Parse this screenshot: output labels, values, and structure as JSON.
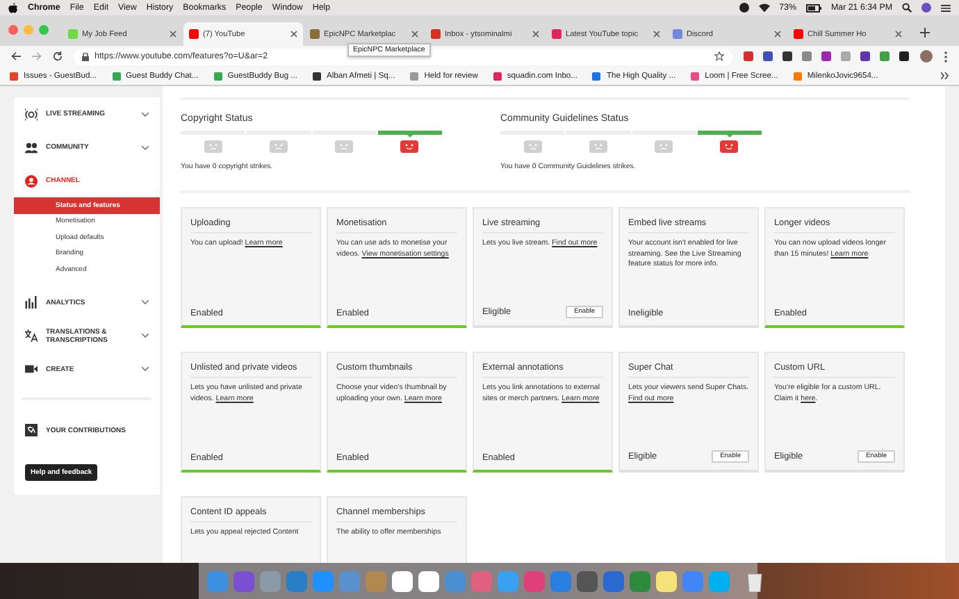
{
  "menubar": {
    "app": "Chrome",
    "menus": [
      "File",
      "Edit",
      "View",
      "History",
      "Bookmarks",
      "People",
      "Window",
      "Help"
    ],
    "battery": "73%",
    "clock": "Mar 21 6:34 PM"
  },
  "tabs": [
    {
      "label": "My Job Feed",
      "selected": false
    },
    {
      "label": "(7) YouTube",
      "selected": true
    },
    {
      "label": "EpicNPC Marketplac",
      "selected": false
    },
    {
      "label": "Inbox - ytsominalmi",
      "selected": false
    },
    {
      "label": "Latest YouTube topic",
      "selected": false
    },
    {
      "label": "Discord",
      "selected": false
    },
    {
      "label": "Chill Summer Ho",
      "selected": false
    }
  ],
  "tooltip": "EpicNPC Marketplace",
  "address_bar": {
    "url": "https://www.youtube.com/features?o=U&ar=2"
  },
  "bookmarks": [
    "Issues - GuestBud...",
    "Guest Buddy Chat...",
    "GuestBuddy Bug ...",
    "Alban Afmeti | Sq...",
    "Held for review",
    "squadin.com Inbo...",
    "The High Quality ...",
    "Loom | Free Scree...",
    "MilenkoJovic9654..."
  ],
  "sidebar": {
    "sections": [
      {
        "label": "LIVE STREAMING",
        "selected": false,
        "collapsed": true
      },
      {
        "label": "COMMUNITY",
        "selected": false,
        "collapsed": true
      },
      {
        "label": "CHANNEL",
        "selected": true,
        "collapsed": false,
        "children": [
          {
            "label": "Status and features",
            "selected": true
          },
          {
            "label": "Monetisation",
            "selected": false
          },
          {
            "label": "Upload defaults",
            "selected": false
          },
          {
            "label": "Branding",
            "selected": false
          },
          {
            "label": "Advanced",
            "selected": false
          }
        ]
      },
      {
        "label": "ANALYTICS",
        "selected": false,
        "collapsed": true
      },
      {
        "label": "TRANSLATIONS & TRANSCRIPTIONS",
        "selected": false,
        "collapsed": true
      },
      {
        "label": "CREATE",
        "selected": false,
        "collapsed": true
      }
    ],
    "footer_item": "YOUR CONTRIBUTIONS",
    "help_button": "Help and feedback"
  },
  "strikes": [
    {
      "title": "Copyright Status",
      "segments": [
        {
          "selected": false
        },
        {
          "selected": false
        },
        {
          "selected": false
        },
        {
          "selected": true
        }
      ],
      "message": "You have 0 copyright strikes."
    },
    {
      "title": "Community Guidelines Status",
      "segments": [
        {
          "selected": false
        },
        {
          "selected": false
        },
        {
          "selected": false
        },
        {
          "selected": true
        }
      ],
      "message": "You have 0 Community Guidelines strikes."
    }
  ],
  "cards": [
    {
      "title": "Uploading",
      "parts": [
        {
          "kind": "text",
          "text": "You can upload! "
        },
        {
          "kind": "link",
          "text": "Learn more"
        }
      ],
      "status": "Enabled",
      "enabled": true
    },
    {
      "title": "Monetisation",
      "parts": [
        {
          "kind": "text",
          "text": "You can use ads to monetise your videos. "
        },
        {
          "kind": "link",
          "text": "View monetisation settings"
        }
      ],
      "status": "Enabled",
      "enabled": true
    },
    {
      "title": "Live streaming",
      "parts": [
        {
          "kind": "text",
          "text": "Lets you live stream. "
        },
        {
          "kind": "link",
          "text": "Find out more"
        }
      ],
      "status": "Eligible",
      "enabled": false,
      "button": "Enable"
    },
    {
      "title": "Embed live streams",
      "parts": [
        {
          "kind": "text",
          "text": "Your account isn't enabled for live streaming. See the Live Streaming feature status for more info."
        }
      ],
      "status": "Ineligible",
      "enabled": false
    },
    {
      "title": "Longer videos",
      "parts": [
        {
          "kind": "text",
          "text": "You can now upload videos longer than 15 minutes! "
        },
        {
          "kind": "link",
          "text": "Learn more"
        }
      ],
      "status": "Enabled",
      "enabled": true
    },
    {
      "title": "Unlisted and private videos",
      "parts": [
        {
          "kind": "text",
          "text": "Lets you have unlisted and private videos. "
        },
        {
          "kind": "link",
          "text": "Learn more"
        }
      ],
      "status": "Enabled",
      "enabled": true
    },
    {
      "title": "Custom thumbnails",
      "parts": [
        {
          "kind": "text",
          "text": "Choose your video's thumbnail by uploading your own. "
        },
        {
          "kind": "link",
          "text": "Learn more"
        }
      ],
      "status": "Enabled",
      "enabled": true
    },
    {
      "title": "External annotations",
      "parts": [
        {
          "kind": "text",
          "text": "Lets you link annotations to external sites or merch partners. "
        },
        {
          "kind": "link",
          "text": "Learn more"
        }
      ],
      "status": "Enabled",
      "enabled": true
    },
    {
      "title": "Super Chat",
      "parts": [
        {
          "kind": "text",
          "text": "Lets your viewers send Super Chats. "
        },
        {
          "kind": "link",
          "text": "Find out more"
        }
      ],
      "status": "Eligible",
      "enabled": false,
      "button": "Enable"
    },
    {
      "title": "Custom URL",
      "parts": [
        {
          "kind": "text",
          "text": "You're eligible for a custom URL. Claim it "
        },
        {
          "kind": "link",
          "text": "here"
        },
        {
          "kind": "text",
          "text": "."
        }
      ],
      "status": "Eligible",
      "enabled": false,
      "button": "Enable"
    },
    {
      "title": "Content ID appeals",
      "parts": [
        {
          "kind": "text",
          "text": "Lets you appeal rejected Content"
        }
      ]
    },
    {
      "title": "Channel memberships",
      "parts": [
        {
          "kind": "text",
          "text": "The ability to offer memberships"
        }
      ]
    }
  ]
}
